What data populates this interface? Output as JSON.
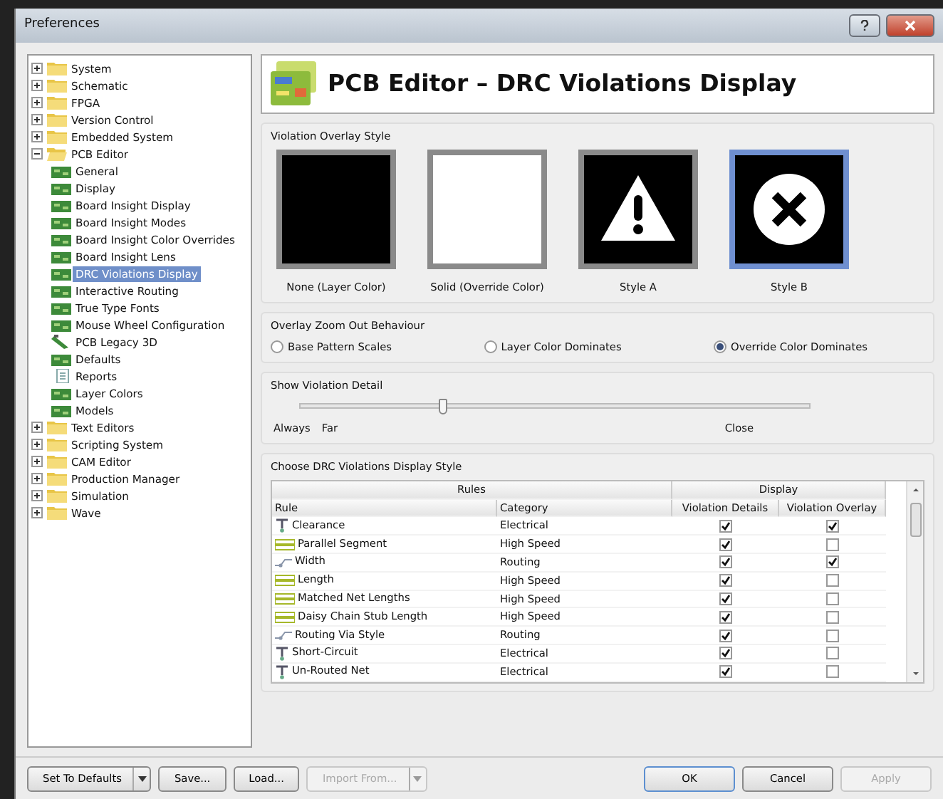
{
  "window": {
    "title": "Preferences"
  },
  "tree": [
    {
      "label": "System",
      "kind": "folder",
      "expanded": false,
      "selected": false
    },
    {
      "label": "Schematic",
      "kind": "folder",
      "expanded": false,
      "selected": false
    },
    {
      "label": "FPGA",
      "kind": "folder",
      "expanded": false,
      "selected": false
    },
    {
      "label": "Version Control",
      "kind": "folder",
      "expanded": false,
      "selected": false
    },
    {
      "label": "Embedded System",
      "kind": "folder",
      "expanded": false,
      "selected": false
    },
    {
      "label": "PCB Editor",
      "kind": "folder",
      "expanded": true,
      "selected": false,
      "children": [
        {
          "label": "General",
          "kind": "board",
          "selected": false
        },
        {
          "label": "Display",
          "kind": "board",
          "selected": false
        },
        {
          "label": "Board Insight Display",
          "kind": "board",
          "selected": false
        },
        {
          "label": "Board Insight Modes",
          "kind": "board",
          "selected": false
        },
        {
          "label": "Board Insight Color Overrides",
          "kind": "board",
          "selected": false
        },
        {
          "label": "Board Insight Lens",
          "kind": "board",
          "selected": false
        },
        {
          "label": "DRC Violations Display",
          "kind": "board",
          "selected": true
        },
        {
          "label": "Interactive Routing",
          "kind": "board",
          "selected": false
        },
        {
          "label": "True Type Fonts",
          "kind": "board",
          "selected": false
        },
        {
          "label": "Mouse Wheel Configuration",
          "kind": "board",
          "selected": false
        },
        {
          "label": "PCB Legacy 3D",
          "kind": "chip",
          "selected": false
        },
        {
          "label": "Defaults",
          "kind": "board",
          "selected": false
        },
        {
          "label": "Reports",
          "kind": "report",
          "selected": false
        },
        {
          "label": "Layer Colors",
          "kind": "board",
          "selected": false
        },
        {
          "label": "Models",
          "kind": "board",
          "selected": false
        }
      ]
    },
    {
      "label": "Text Editors",
      "kind": "folder",
      "expanded": false,
      "selected": false
    },
    {
      "label": "Scripting System",
      "kind": "folder",
      "expanded": false,
      "selected": false
    },
    {
      "label": "CAM Editor",
      "kind": "folder",
      "expanded": false,
      "selected": false
    },
    {
      "label": "Production Manager",
      "kind": "folder",
      "expanded": false,
      "selected": false
    },
    {
      "label": "Simulation",
      "kind": "folder",
      "expanded": false,
      "selected": false
    },
    {
      "label": "Wave",
      "kind": "folder",
      "expanded": false,
      "selected": false
    }
  ],
  "page_title": "PCB Editor – DRC Violations Display",
  "overlay_style": {
    "heading": "Violation Overlay Style",
    "options": [
      {
        "label": "None (Layer Color)",
        "kind": "black",
        "selected": false
      },
      {
        "label": "Solid (Override Color)",
        "kind": "white",
        "selected": false
      },
      {
        "label": "Style A",
        "kind": "warning",
        "selected": false
      },
      {
        "label": "Style B",
        "kind": "cross",
        "selected": true
      }
    ]
  },
  "zoom_out": {
    "heading": "Overlay Zoom Out Behaviour",
    "options": [
      {
        "label": "Base Pattern Scales",
        "selected": false
      },
      {
        "label": "Layer Color Dominates",
        "selected": false
      },
      {
        "label": "Override Color Dominates",
        "selected": true
      }
    ]
  },
  "violation_detail": {
    "heading": "Show Violation Detail",
    "level": 0.28,
    "labels": [
      "Always",
      "Far",
      "Close"
    ]
  },
  "display_style": {
    "heading": "Choose DRC Violations Display Style",
    "groups": [
      "Rules",
      "Display"
    ],
    "columns": [
      "Rule",
      "Category",
      "Violation Details",
      "Violation Overlay"
    ],
    "rows": [
      {
        "rule": "Clearance",
        "kind": "electrical",
        "category": "Electrical",
        "details": true,
        "overlay": true
      },
      {
        "rule": "Parallel Segment",
        "kind": "highspeed",
        "category": "High Speed",
        "details": true,
        "overlay": false
      },
      {
        "rule": "Width",
        "kind": "routing",
        "category": "Routing",
        "details": true,
        "overlay": true
      },
      {
        "rule": "Length",
        "kind": "highspeed",
        "category": "High Speed",
        "details": true,
        "overlay": false
      },
      {
        "rule": "Matched Net Lengths",
        "kind": "highspeed",
        "category": "High Speed",
        "details": true,
        "overlay": false
      },
      {
        "rule": "Daisy Chain Stub Length",
        "kind": "highspeed",
        "category": "High Speed",
        "details": true,
        "overlay": false
      },
      {
        "rule": "Routing Via Style",
        "kind": "routing",
        "category": "Routing",
        "details": true,
        "overlay": false
      },
      {
        "rule": "Short-Circuit",
        "kind": "electrical",
        "category": "Electrical",
        "details": true,
        "overlay": false
      },
      {
        "rule": "Un-Routed Net",
        "kind": "electrical",
        "category": "Electrical",
        "details": true,
        "overlay": false
      }
    ]
  },
  "buttons": [
    {
      "label": "Set To Defaults",
      "dropdown": true,
      "disabled": false,
      "default": false
    },
    {
      "label": "Save...",
      "dropdown": false,
      "disabled": false,
      "default": false
    },
    {
      "label": "Load...",
      "dropdown": false,
      "disabled": false,
      "default": false
    },
    {
      "label": "Import From...",
      "dropdown": true,
      "disabled": true,
      "default": false
    },
    {
      "label": "OK",
      "dropdown": false,
      "disabled": false,
      "default": true
    },
    {
      "label": "Cancel",
      "dropdown": false,
      "disabled": false,
      "default": false
    },
    {
      "label": "Apply",
      "dropdown": false,
      "disabled": true,
      "default": false
    }
  ]
}
